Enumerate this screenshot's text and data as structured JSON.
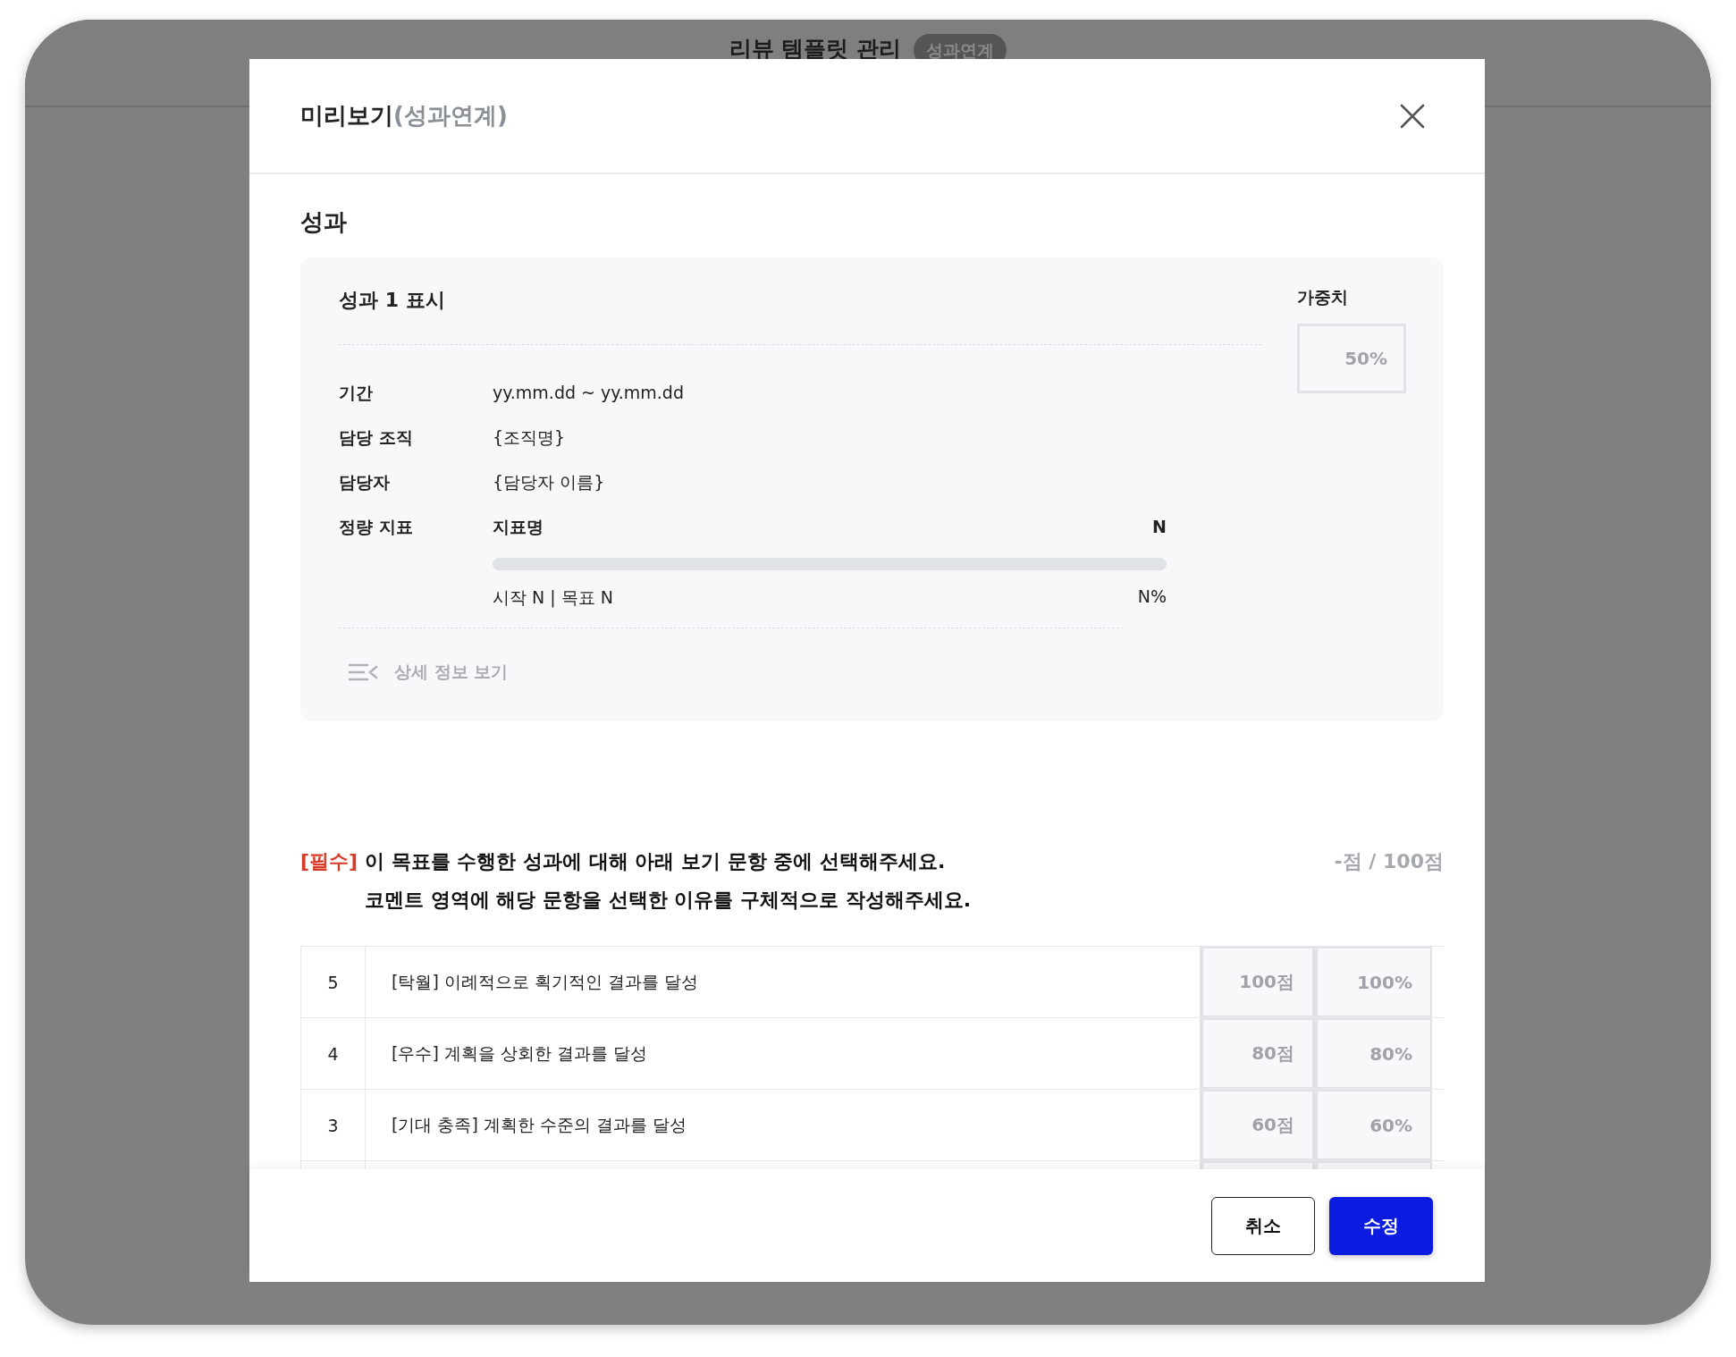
{
  "background": {
    "title": "리뷰 템플릿 관리",
    "badge": "성과연계"
  },
  "modal": {
    "title": "미리보기",
    "title_suffix": "(성과연계)"
  },
  "section_title": "성과",
  "card": {
    "title": "성과 1 표시",
    "fields": [
      {
        "label": "기간",
        "value": "yy.mm.dd ~ yy.mm.dd"
      },
      {
        "label": "담당 조직",
        "value": "{조직명}"
      },
      {
        "label": "담당자",
        "value": "{담당자 이름}"
      }
    ],
    "metric": {
      "label": "정량 지표",
      "name": "지표명",
      "value": "N",
      "level": 0,
      "range": "시작 N | 목표 N",
      "percent": "N%"
    },
    "detail_link": "상세 정보 보기",
    "weight": {
      "label": "가중치",
      "placeholder": "50%"
    }
  },
  "question": {
    "required": "[필수]",
    "lines": [
      "이 목표를 수행한 성과에 대해 아래 보기 문항 중에 선택해주세요.",
      "코멘트 영역에 해당 문항을 선택한 이유를 구체적으로 작성해주세요."
    ],
    "score": "-점 / 100점"
  },
  "options": [
    {
      "grade": "5",
      "text": "[탁월] 이례적으로 획기적인 결과를 달성",
      "points": "100점",
      "percent": "100%"
    },
    {
      "grade": "4",
      "text": "[우수] 계획을 상회한 결과를 달성",
      "points": "80점",
      "percent": "80%"
    },
    {
      "grade": "3",
      "text": "[기대 충족] 계획한 수준의 결과를 달성",
      "points": "60점",
      "percent": "60%"
    }
  ],
  "buttons": [
    {
      "label": "취소",
      "kind": "secondary"
    },
    {
      "label": "수정",
      "kind": "primary"
    }
  ]
}
